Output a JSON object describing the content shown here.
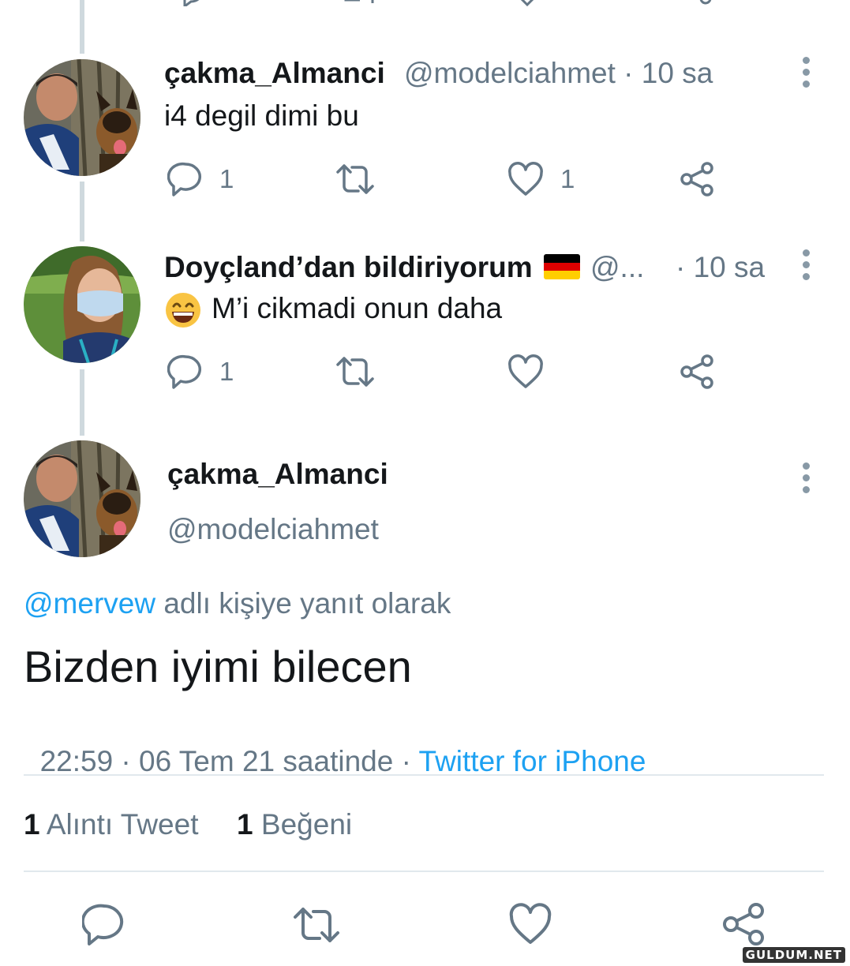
{
  "tweets": [
    {
      "display_name": "çakma_Almanci",
      "handle_time": "@modelciahmet · 10 sa",
      "text": "i4 degil dimi bu",
      "reply_count": "1",
      "like_count": "1"
    },
    {
      "display_name": "Doyçland’dan bildiriyorum",
      "handle": "@...",
      "time": "· 10 sa",
      "emoji": "😄",
      "text": "M’i cikmadi onun daha",
      "reply_count": "1"
    }
  ],
  "main_tweet": {
    "display_name": "çakma_Almanci",
    "handle": "@modelciahmet",
    "reply_to_user": "@mervew",
    "reply_to_suffix": "adlı kişiye yanıt olarak",
    "text": "Bizden iyimi bilecen",
    "timestamp": "22:59 · 06 Tem 21 saatinde · ",
    "source": "Twitter for iPhone",
    "quote_count": "1",
    "quote_label": "Alıntı Tweet",
    "like_count": "1",
    "like_label": "Beğeni"
  },
  "watermark": "GULDUM.NET",
  "colors": {
    "accent": "#1da1f2",
    "muted": "#657786",
    "text": "#14171a"
  }
}
